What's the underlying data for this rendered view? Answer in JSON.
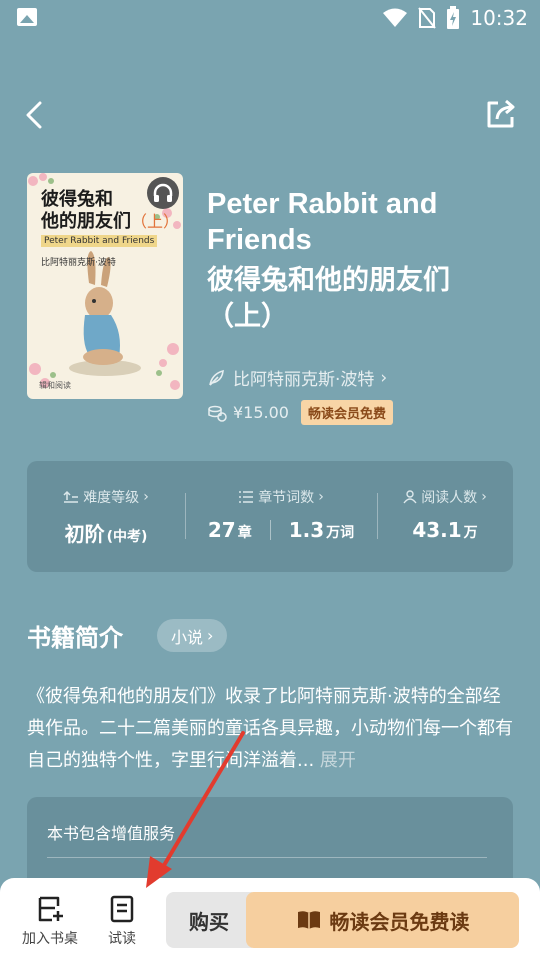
{
  "status_bar": {
    "time": "10:32"
  },
  "book": {
    "title_en": "Peter Rabbit and Friends",
    "title_cn": "彼得兔和他的朋友们（上）",
    "author": "比阿特丽克斯·波特",
    "price": "¥15.00",
    "vip_badge": "畅读会员免费"
  },
  "cover": {
    "title_line1": "彼得兔和",
    "title_line2": "他的朋友们",
    "title_part": "（上）",
    "title_en": "Peter Rabbit and Friends",
    "author": "比阿特丽克斯·波特",
    "publisher": "辑和阅读"
  },
  "stats": [
    {
      "label": "难度等级",
      "value": "初阶",
      "unit": "(中考)"
    },
    {
      "label": "章节词数",
      "value": "27",
      "unit": "章",
      "value2": "1.3",
      "unit2": "万词"
    },
    {
      "label": "阅读人数",
      "value": "43.1",
      "unit": "万"
    }
  ],
  "intro": {
    "title": "书籍简介",
    "genre": "小说",
    "text": "《彼得兔和他的朋友们》收录了比阿特丽克斯·波特的全部经典作品。二十二篇美丽的童话各具异趣，小动物们每一个都有自己的独特个性，字里行间洋溢着...",
    "expand": "展开"
  },
  "service": {
    "title": "本书包含增值服务"
  },
  "bottom": {
    "add_shelf": "加入书桌",
    "trial": "试读",
    "buy": "购买",
    "vip_read": "畅读会员免费读"
  },
  "colors": {
    "background": "#7aa4b0",
    "vip_button": "#f6cf9f",
    "arrow": "#e23b2e"
  }
}
